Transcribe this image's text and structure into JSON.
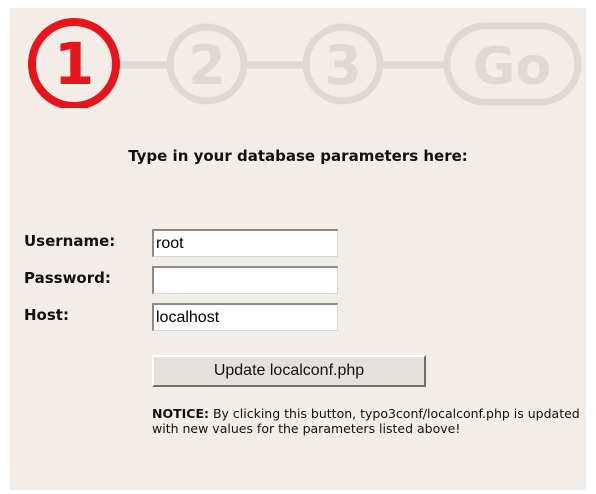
{
  "steps": [
    {
      "label": "1",
      "state": "active"
    },
    {
      "label": "2",
      "state": "inactive"
    },
    {
      "label": "3",
      "state": "inactive"
    },
    {
      "label": "Go",
      "state": "inactive"
    }
  ],
  "colors": {
    "active_step": "#e8141c",
    "inactive_step": "#dedad3",
    "panel": "#f2eee7"
  },
  "form": {
    "heading": "Type in your database parameters here:",
    "username": {
      "label": "Username:",
      "value": "root"
    },
    "password": {
      "label": "Password:",
      "value": ""
    },
    "host": {
      "label": "Host:",
      "value": "localhost"
    },
    "submit_label": "Update localconf.php"
  },
  "notice": {
    "prefix": "NOTICE:",
    "text": " By clicking this button, typo3conf/localconf.php is updated with new values for the parameters listed above!"
  }
}
